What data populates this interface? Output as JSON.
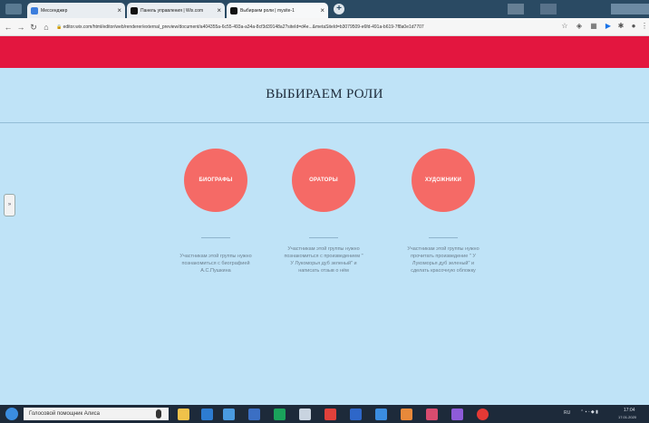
{
  "browser": {
    "tabs": [
      {
        "title": "Мессенджер",
        "favicon_color": "#3b7ddd"
      },
      {
        "title": "Панель управления | Wix.com",
        "favicon_color": "#111111"
      },
      {
        "title": "Выбираем роли | mysite-1",
        "favicon_color": "#111111"
      }
    ],
    "url": "editor.wix.com/html/editor/web/renderer/external_preview/document/a404355a-6c55-493a-a34a-8cf3d39148a2?siteId=d4e...&metaSiteId=b3079509-e6fd-491a-b619-7f8a0e1d7707"
  },
  "site": {
    "title": "ВЫБИРАЕМ РОЛИ",
    "side_tab_label": "»",
    "roles": [
      {
        "name": "БИОГРАФЫ",
        "description": "Участникам этой группы нужно познакомиться с биографией А.С.Пушкина"
      },
      {
        "name": "ОРАТОРЫ",
        "description": "Участникам этой группы нужно познакомиться с произведением \" У Лукоморья дуб зеленый\" и написать отзыв о нём"
      },
      {
        "name": "ХУДОЖНИКИ",
        "description": "Участникам этой группы нужно прочитать произведение \" У Лукоморья дуб зеленый\" и сделать красочную обложку"
      }
    ]
  },
  "taskbar": {
    "search_text": "Голосовой помощник Алиса",
    "tray_lang": "RU",
    "clock_time": "17:04",
    "clock_date": "17.01.2020"
  },
  "colors": {
    "header": "#e3163f",
    "page_bg": "#bfe3f7",
    "circle": "#f56a66"
  }
}
